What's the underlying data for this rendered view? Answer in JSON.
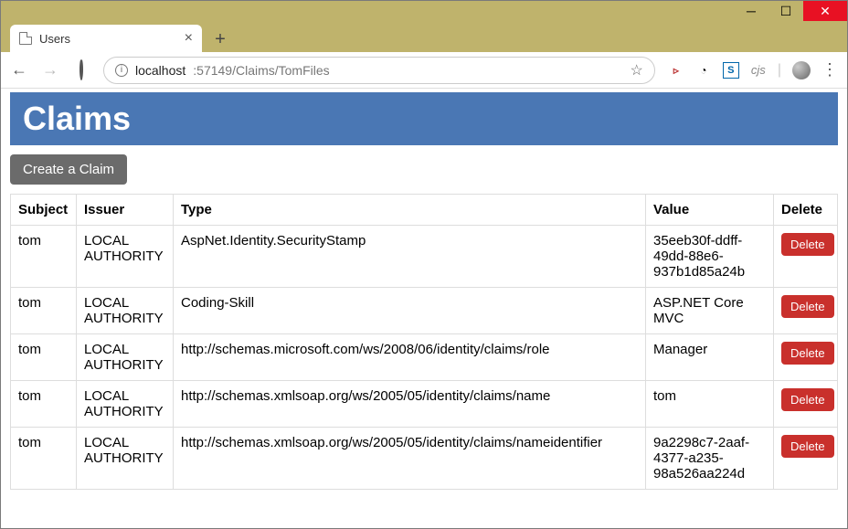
{
  "window": {
    "tab_title": "Users"
  },
  "address": {
    "host": "localhost",
    "port_path": ":57149/Claims/TomFiles"
  },
  "extensions": {
    "cjs_label": "cjs"
  },
  "page": {
    "heading": "Claims",
    "create_label": "Create a Claim"
  },
  "table": {
    "headers": {
      "subject": "Subject",
      "issuer": "Issuer",
      "type": "Type",
      "value": "Value",
      "delete": "Delete"
    },
    "delete_label": "Delete",
    "rows": [
      {
        "subject": "tom",
        "issuer": "LOCAL AUTHORITY",
        "type": "AspNet.Identity.SecurityStamp",
        "value": "35eeb30f-ddff-49dd-88e6-937b1d85a24b"
      },
      {
        "subject": "tom",
        "issuer": "LOCAL AUTHORITY",
        "type": "Coding-Skill",
        "value": "ASP.NET Core MVC"
      },
      {
        "subject": "tom",
        "issuer": "LOCAL AUTHORITY",
        "type": "http://schemas.microsoft.com/ws/2008/06/identity/claims/role",
        "value": "Manager"
      },
      {
        "subject": "tom",
        "issuer": "LOCAL AUTHORITY",
        "type": "http://schemas.xmlsoap.org/ws/2005/05/identity/claims/name",
        "value": "tom"
      },
      {
        "subject": "tom",
        "issuer": "LOCAL AUTHORITY",
        "type": "http://schemas.xmlsoap.org/ws/2005/05/identity/claims/nameidentifier",
        "value": "9a2298c7-2aaf-4377-a235-98a526aa224d"
      }
    ]
  }
}
